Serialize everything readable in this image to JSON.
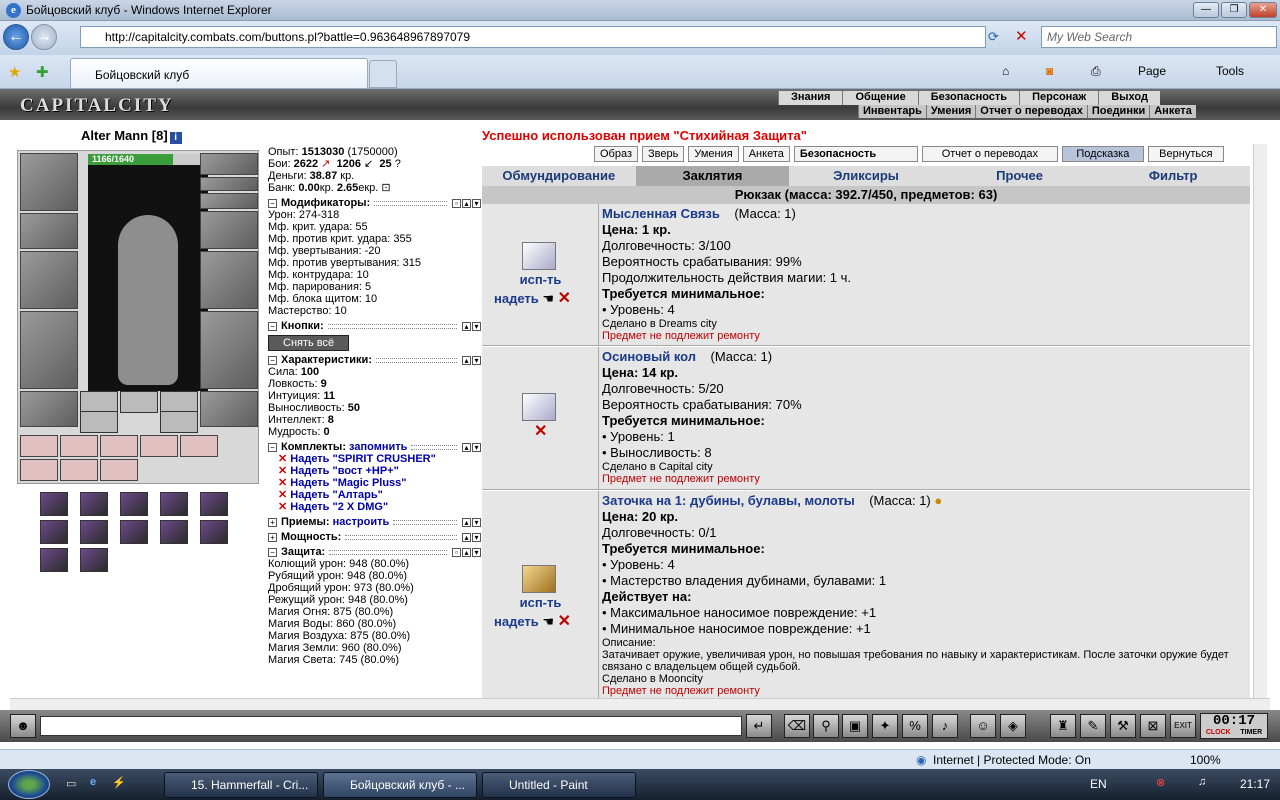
{
  "window": {
    "title": "Бойцовский клуб - Windows Internet Explorer"
  },
  "browser": {
    "url": "http://capitalcity.combats.com/buttons.pl?battle=0.963648967897079",
    "search_placeholder": "My Web Search",
    "tab_title": "Бойцовский клуб",
    "page_label": "Page",
    "tools_label": "Tools"
  },
  "game": {
    "logo": "CAPITALCITY",
    "menu_top": [
      "Знания",
      "Общение",
      "Безопасность",
      "Персонаж",
      "Выход"
    ],
    "menu_bottom": [
      "Инвентарь",
      "Умения",
      "Отчет о переводах",
      "Поединки",
      "Анкета"
    ]
  },
  "character": {
    "name": "Alter Mann",
    "level": "[8]",
    "hp": "1166/1640",
    "hp_fraction": 0.71,
    "exp_label": "Опыт:",
    "exp": "1513030",
    "exp_next": "(1750000)",
    "fights_label": "Бои:",
    "wins": "2622",
    "losses": "1206",
    "draws": "25",
    "money_label": "Деньги:",
    "money": "38.87",
    "money_unit": "кр.",
    "bank_label": "Банк:",
    "bank_kr": "0.00",
    "bank_kr_unit": "кр.",
    "bank_ekr": "2.65",
    "bank_ekr_unit": "екр."
  },
  "sections": {
    "modifiers": "Модификаторы:",
    "buttons": "Кнопки:",
    "characteristics": "Характеристики:",
    "sets": "Комплекты:",
    "sets_remember": "запомнить",
    "techniques": "Приемы:",
    "techniques_config": "настроить",
    "power": "Мощность:",
    "defense": "Защита:"
  },
  "modifiers": [
    "Урон: 274-318",
    "Мф. крит. удара: 55",
    "Мф. против крит. удара: 355",
    "Мф. увертывания: -20",
    "Мф. против увертывания: 315",
    "Мф. контрудара: 10",
    "Мф. парирования: 5",
    "Мф. блока щитом: 10",
    "Мастерство: 10"
  ],
  "remove_all": "Снять всё",
  "characteristics": [
    {
      "label": "Сила: ",
      "value": "100"
    },
    {
      "label": "Ловкость: ",
      "value": "9"
    },
    {
      "label": "Интуиция: ",
      "value": "11"
    },
    {
      "label": "Выносливость: ",
      "value": "50"
    },
    {
      "label": "Интеллект: ",
      "value": "8"
    },
    {
      "label": "Мудрость: ",
      "value": "0"
    }
  ],
  "sets": [
    "Надеть \"SPIRIT CRUSHER\"",
    "Надеть \"вост +HP+\"",
    "Надеть \"Magic Pluss\"",
    "Надеть \"Алтарь\"",
    "Надеть \"2 X DMG\""
  ],
  "defense": [
    "Колющий урон: 948 (80.0%)",
    "Рубящий урон: 948 (80.0%)",
    "Дробящий урон: 973 (80.0%)",
    "Режущий урон: 948 (80.0%)",
    "Магия Огня: 875 (80.0%)",
    "Магия Воды: 860 (80.0%)",
    "Магия Воздуха: 875 (80.0%)",
    "Магия Земли: 960 (80.0%)",
    "Магия Света: 745 (80.0%)"
  ],
  "message": "Успешно использован прием \"Стихийная Защита\"",
  "toolbar": [
    "Образ",
    "Зверь",
    "Умения",
    "Анкета",
    "Безопасность",
    "Отчет о переводах",
    "Подсказка",
    "Вернуться"
  ],
  "categories": [
    "Обмундирование",
    "Заклятия",
    "Эликсиры",
    "Прочее",
    "Фильтр"
  ],
  "backpack": "Рюкзак (масса: 392.7/450, предметов: 63)",
  "actions": {
    "use": "исп-ть",
    "wear": "надеть"
  },
  "items": [
    {
      "name": "Мысленная Связь",
      "mass": "(Масса: 1)",
      "price": "Цена: 1 кр.",
      "lines": [
        "Долговечность: 3/100",
        "Вероятность срабатывания: 99%",
        "Продолжительность действия магии: 1 ч."
      ],
      "req_title": "Требуется минимальное:",
      "reqs": [
        "• Уровень: 4"
      ],
      "made": "Сделано в Dreams city",
      "repair": "Предмет не подлежит ремонту"
    },
    {
      "name": "Осиновый кол",
      "mass": "(Масса: 1)",
      "price": "Цена: 14 кр.",
      "lines": [
        "Долговечность: 5/20",
        "Вероятность срабатывания: 70%"
      ],
      "req_title": "Требуется минимальное:",
      "reqs": [
        "• Уровень: 1",
        "• Выносливость: 8"
      ],
      "made": "Сделано в Capital city",
      "repair": "Предмет не подлежит ремонту"
    },
    {
      "name": "Заточка на 1: дубины, булавы, молоты",
      "mass": "(Масса: 1)",
      "price": "Цена: 20 кр.",
      "lines": [
        "Долговечность: 0/1"
      ],
      "req_title": "Требуется минимальное:",
      "reqs": [
        "• Уровень: 4",
        "• Мастерство владения дубинами, булавами: 1"
      ],
      "acts_title": "Действует на:",
      "acts": [
        "• Максимальное наносимое повреждение: +1",
        "• Минимальное наносимое повреждение: +1"
      ],
      "desc_label": "Описание:",
      "desc": "Затачивает оружие, увеличивая урон, но повышая требования по навыку и характеристикам. После заточки оружие будет связано с владельцем общей судьбой.",
      "made": "Сделано в Mooncity",
      "repair": "Предмет не подлежит ремонту"
    }
  ],
  "clock": {
    "time": "00:17",
    "label1": "CLOCK",
    "label2": "TIMER"
  },
  "status": {
    "zone": "Internet | Protected Mode: On",
    "zoom": "100%"
  },
  "taskbar": {
    "tasks": [
      "15. Hammerfall - Cri...",
      "Бойцовский клуб - ...",
      "Untitled - Paint"
    ],
    "lang": "EN",
    "time": "21:17"
  }
}
